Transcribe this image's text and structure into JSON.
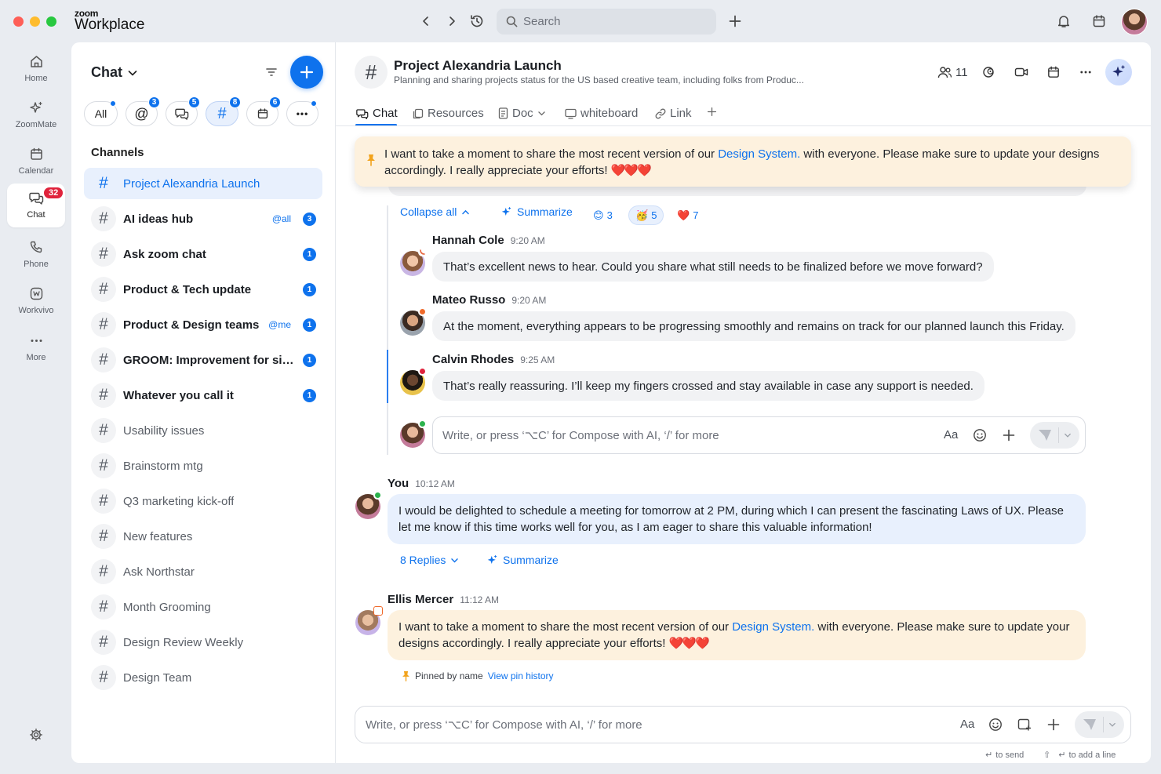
{
  "app": {
    "brand_small": "zoom",
    "brand_large": "Workplace"
  },
  "titlebar": {
    "search_placeholder": "Search"
  },
  "rail": {
    "items": [
      {
        "label": "Home"
      },
      {
        "label": "ZoomMate"
      },
      {
        "label": "Calendar"
      },
      {
        "label": "Chat",
        "badge": "32"
      },
      {
        "label": "Phone"
      },
      {
        "label": "Workvivo"
      },
      {
        "label": "More"
      }
    ]
  },
  "sidebar": {
    "title": "Chat",
    "filters": [
      {
        "label": "All",
        "dot": true
      },
      {
        "label": "@",
        "badge": "3"
      },
      {
        "label": "chats",
        "badge": "5"
      },
      {
        "label": "#",
        "badge": "8"
      },
      {
        "label": "calendar",
        "badge": "6"
      },
      {
        "label": "•••",
        "dot": true
      }
    ],
    "channels_heading": "Channels",
    "channels": [
      {
        "name": "Project Alexandria Launch"
      },
      {
        "name": "AI ideas hub",
        "mention": "@all",
        "count": "3"
      },
      {
        "name": "Ask zoom chat",
        "count": "1"
      },
      {
        "name": "Product & Tech update",
        "count": "1"
      },
      {
        "name": "Product & Design teams",
        "mention": "@me",
        "count": "1"
      },
      {
        "name": "GROOM: Improvement for sidebar",
        "count": "1"
      },
      {
        "name": "Whatever you call it",
        "count": "1"
      },
      {
        "name": "Usability issues"
      },
      {
        "name": "Brainstorm mtg"
      },
      {
        "name": "Q3 marketing kick-off"
      },
      {
        "name": "New features"
      },
      {
        "name": "Ask Northstar"
      },
      {
        "name": "Month Grooming"
      },
      {
        "name": "Design Review Weekly"
      },
      {
        "name": "Design Team"
      }
    ]
  },
  "channel": {
    "title": "Project Alexandria Launch",
    "description": "Planning and sharing projects status for the US based creative team, including folks from Produc...",
    "members": "11"
  },
  "tabs": [
    "Chat",
    "Resources",
    "Doc",
    "whiteboard",
    "Link"
  ],
  "pinned": {
    "text_before": "I want to take a moment to share the most recent version of our ",
    "link": "Design System.",
    "text_after": " with everyone. Please make sure to update your designs accordingly. I really appreciate your efforts! ",
    "hearts": "❤️❤️❤️"
  },
  "thread": {
    "collapse": "Collapse all",
    "summarize": "Summarize",
    "reactions": [
      {
        "emoji": "😊",
        "count": "3"
      },
      {
        "emoji": "🥳",
        "count": "5"
      },
      {
        "emoji": "❤️",
        "count": "7"
      }
    ],
    "replies": [
      {
        "sender": "Hannah Cole",
        "time": "9:20 AM",
        "text": "That’s excellent news to hear. Could you share what still needs to be finalized before we move forward?"
      },
      {
        "sender": "Mateo Russo",
        "time": "9:20 AM",
        "text": "At the moment, everything appears to be progressing smoothly and remains on track for our planned launch this Friday."
      },
      {
        "sender": "Calvin Rhodes",
        "time": "9:25 AM",
        "text": "That’s really reassuring. I’ll keep my fingers crossed and stay available in case any support is needed."
      }
    ],
    "reply_placeholder": "Write, or press ‘⌥C’ for Compose with AI, ‘/’ for more"
  },
  "messages": {
    "you": {
      "sender": "You",
      "time": "10:12 AM",
      "text": "I would be delighted to schedule a meeting for tomorrow at 2 PM, during which I can present the fascinating Laws of UX. Please let me know if this time works well for you, as I am eager to share this valuable information!",
      "replies": "8 Replies",
      "summarize": "Summarize"
    },
    "ellis": {
      "sender": "Ellis Mercer",
      "time": "11:12 AM",
      "text_before": "I want to take a moment to share the most recent version of our ",
      "link": "Design System.",
      "text_after": " with everyone. Please make sure to update your designs accordingly. I really appreciate your efforts! ",
      "hearts": "❤️❤️❤️",
      "pinned_by": "Pinned by name",
      "pin_history": "View pin history"
    }
  },
  "composer": {
    "placeholder": "Write, or press ‘⌥C’ for Compose with AI, ‘/’ for more",
    "format_label": "Aa",
    "hint_send": "to send",
    "hint_newline": "to add a line"
  },
  "colors": {
    "accent": "#0e72ed",
    "badge_red": "#e0233c",
    "pin_bg": "#fdf1de",
    "self_bubble": "#e8f0fd"
  }
}
